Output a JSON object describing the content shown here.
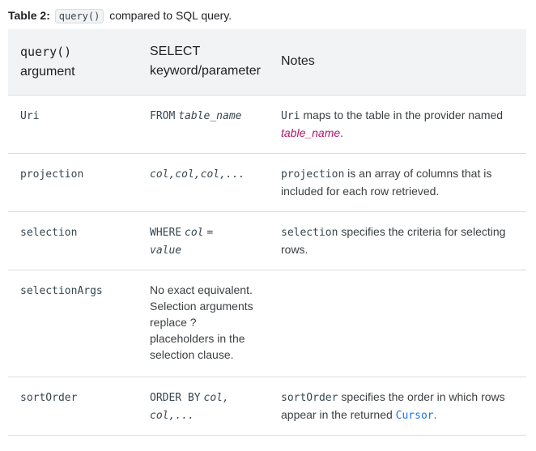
{
  "caption": {
    "label": "Table 2:",
    "code": "query()",
    "text": "compared to SQL query."
  },
  "table": {
    "headers": {
      "col1_line1": "query()",
      "col1_line2": "argument",
      "col2_line1": "SELECT",
      "col2_line2": "keyword/parameter",
      "col3": "Notes"
    },
    "rows": [
      {
        "argument": "Uri",
        "select_kw": "FROM",
        "select_param": "table_name",
        "notes_code": "Uri",
        "notes_text": "maps to the table in the provider named",
        "notes_var": "table_name",
        "notes_end": "."
      },
      {
        "argument": "projection",
        "select_param": "col,col,col,...",
        "notes_code": "projection",
        "notes_text": "is an array of columns that is included for each row retrieved."
      },
      {
        "argument": "selection",
        "select_kw": "WHERE",
        "select_param1": "col",
        "select_eq": "=",
        "select_param2": "value",
        "notes_code": "selection",
        "notes_text": "specifies the criteria for selecting rows."
      },
      {
        "argument": "selectionArgs",
        "select_text": "No exact equivalent. Selection arguments replace ? placeholders in the selection clause."
      },
      {
        "argument": "sortOrder",
        "select_kw": "ORDER BY",
        "select_param": "col,",
        "select_param_line2": "col,...",
        "notes_code": "sortOrder",
        "notes_text": "specifies the order in which rows appear in the returned",
        "notes_link": "Cursor",
        "notes_end": "."
      }
    ]
  }
}
